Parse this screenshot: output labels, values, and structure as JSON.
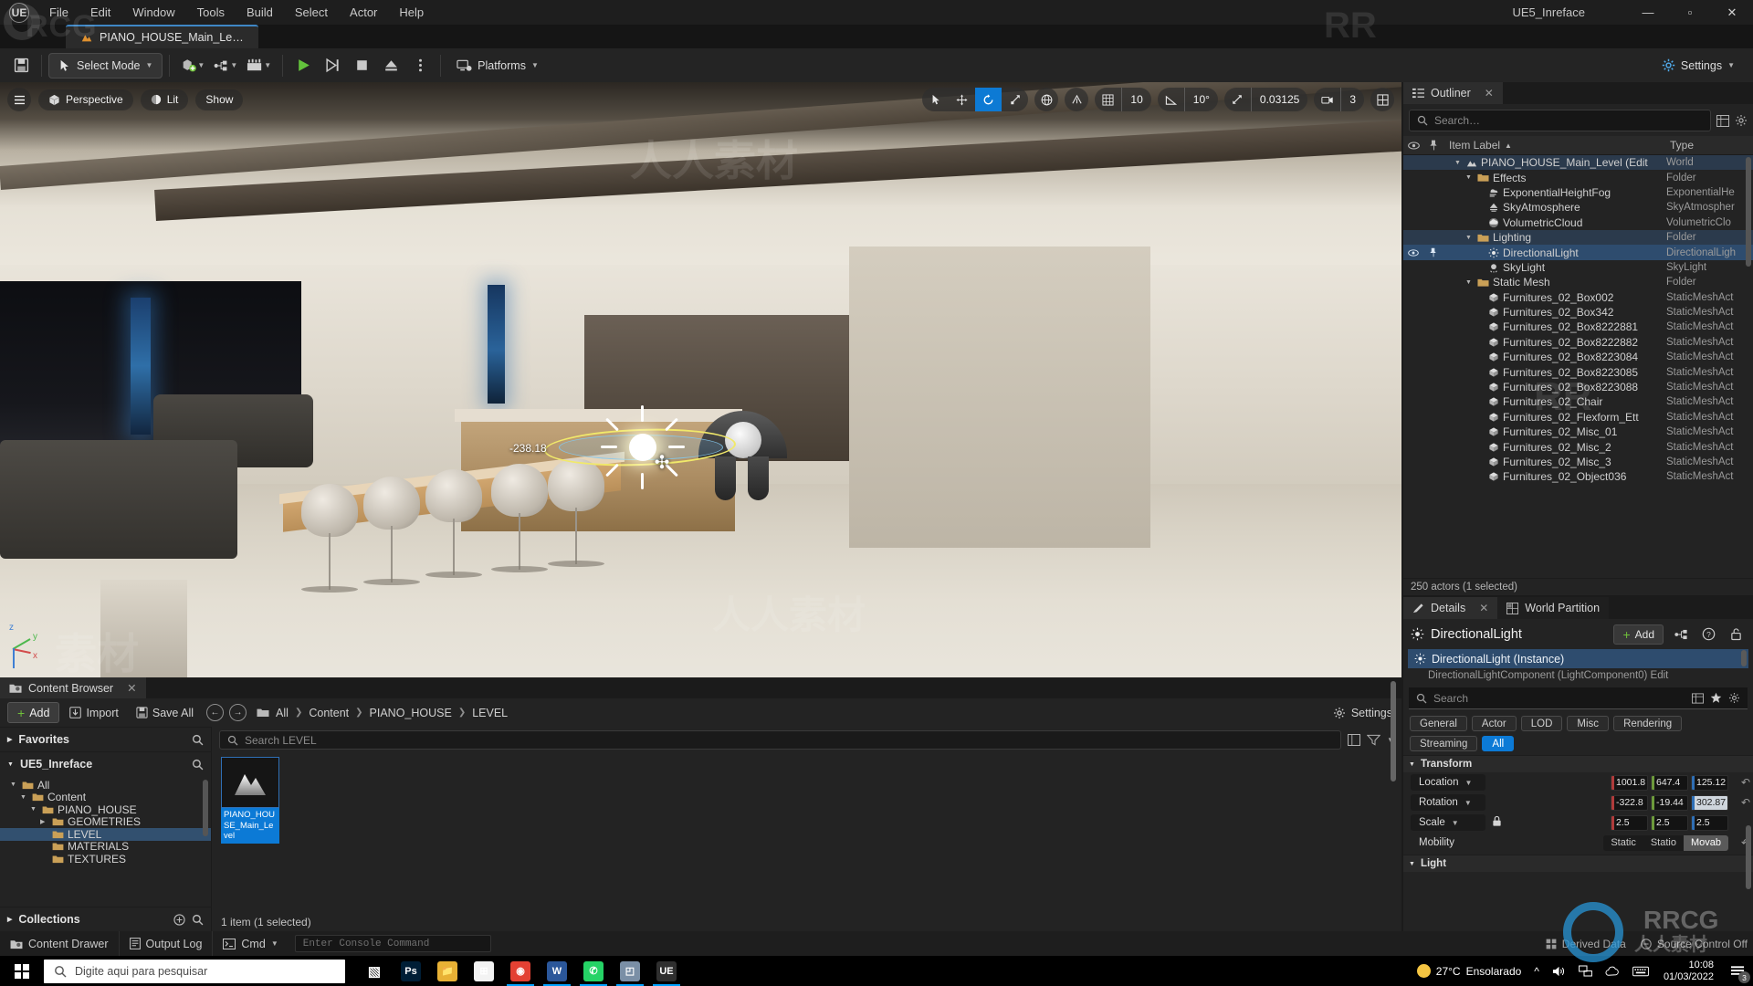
{
  "titlebar": {
    "menus": [
      "File",
      "Edit",
      "Window",
      "Tools",
      "Build",
      "Select",
      "Actor",
      "Help"
    ],
    "project": "UE5_Inreface",
    "minimize": "—",
    "maximize": "▫",
    "close": "✕"
  },
  "level_tab": {
    "label": "PIANO_HOUSE_Main_Le…"
  },
  "toolbar": {
    "save_icon": "save-icon",
    "select_mode": "Select Mode",
    "platforms": "Platforms",
    "settings": "Settings",
    "play_icon": "play-icon",
    "skip_icon": "skip-icon",
    "stop_icon": "stop-icon",
    "eject_icon": "eject-icon",
    "more_icon": "more-options-icon"
  },
  "viewport": {
    "menu_icon": "hamburger-icon",
    "perspective": "Perspective",
    "lit": "Lit",
    "show": "Show",
    "grid_snap": "10",
    "angle_snap": "10°",
    "scale_snap": "0.03125",
    "camera_speed": "3",
    "coord_label": "-238.18",
    "axis_x": "x",
    "axis_y": "y",
    "axis_z": "z"
  },
  "outliner": {
    "tab": "Outliner",
    "close": "✕",
    "search_placeholder": "Search…",
    "col_item_label": "Item Label",
    "col_type": "Type",
    "sort_arrow": "▲",
    "status": "250 actors (1 selected)",
    "rows": [
      {
        "label": "PIANO_HOUSE_Main_Level (Edit",
        "type": "World",
        "indent": 1,
        "icon": "level-icon",
        "expand": "▼",
        "state": "hl",
        "eye": false,
        "pin": false
      },
      {
        "label": "Effects",
        "type": "Folder",
        "indent": 2,
        "icon": "folder-icon",
        "expand": "▼",
        "state": "",
        "eye": false,
        "pin": false
      },
      {
        "label": "ExponentialHeightFog",
        "type": "ExponentialHe",
        "indent": 3,
        "icon": "fog-icon",
        "expand": "",
        "state": "",
        "eye": false,
        "pin": false
      },
      {
        "label": "SkyAtmosphere",
        "type": "SkyAtmospher",
        "indent": 3,
        "icon": "atmosphere-icon",
        "expand": "",
        "state": "",
        "eye": false,
        "pin": false
      },
      {
        "label": "VolumetricCloud",
        "type": "VolumetricClo",
        "indent": 3,
        "icon": "cloud-icon",
        "expand": "",
        "state": "",
        "eye": false,
        "pin": false
      },
      {
        "label": "Lighting",
        "type": "Folder",
        "indent": 2,
        "icon": "folder-icon",
        "expand": "▼",
        "state": "hl",
        "eye": false,
        "pin": false
      },
      {
        "label": "DirectionalLight",
        "type": "DirectionalLigh",
        "indent": 3,
        "icon": "light-icon",
        "expand": "",
        "state": "sel",
        "eye": true,
        "pin": true
      },
      {
        "label": "SkyLight",
        "type": "SkyLight",
        "indent": 3,
        "icon": "skylight-icon",
        "expand": "",
        "state": "",
        "eye": false,
        "pin": false
      },
      {
        "label": "Static Mesh",
        "type": "Folder",
        "indent": 2,
        "icon": "folder-icon",
        "expand": "▼",
        "state": "",
        "eye": false,
        "pin": false
      },
      {
        "label": "Furnitures_02_Box002",
        "type": "StaticMeshAct",
        "indent": 3,
        "icon": "mesh-icon",
        "expand": "",
        "state": "",
        "eye": false,
        "pin": false
      },
      {
        "label": "Furnitures_02_Box342",
        "type": "StaticMeshAct",
        "indent": 3,
        "icon": "mesh-icon",
        "expand": "",
        "state": "",
        "eye": false,
        "pin": false
      },
      {
        "label": "Furnitures_02_Box8222881",
        "type": "StaticMeshAct",
        "indent": 3,
        "icon": "mesh-icon",
        "expand": "",
        "state": "",
        "eye": false,
        "pin": false
      },
      {
        "label": "Furnitures_02_Box8222882",
        "type": "StaticMeshAct",
        "indent": 3,
        "icon": "mesh-icon",
        "expand": "",
        "state": "",
        "eye": false,
        "pin": false
      },
      {
        "label": "Furnitures_02_Box8223084",
        "type": "StaticMeshAct",
        "indent": 3,
        "icon": "mesh-icon",
        "expand": "",
        "state": "",
        "eye": false,
        "pin": false
      },
      {
        "label": "Furnitures_02_Box8223085",
        "type": "StaticMeshAct",
        "indent": 3,
        "icon": "mesh-icon",
        "expand": "",
        "state": "",
        "eye": false,
        "pin": false
      },
      {
        "label": "Furnitures_02_Box8223088",
        "type": "StaticMeshAct",
        "indent": 3,
        "icon": "mesh-icon",
        "expand": "",
        "state": "",
        "eye": false,
        "pin": false
      },
      {
        "label": "Furnitures_02_Chair",
        "type": "StaticMeshAct",
        "indent": 3,
        "icon": "mesh-icon",
        "expand": "",
        "state": "",
        "eye": false,
        "pin": false
      },
      {
        "label": "Furnitures_02_Flexform_Ett",
        "type": "StaticMeshAct",
        "indent": 3,
        "icon": "mesh-icon",
        "expand": "",
        "state": "",
        "eye": false,
        "pin": false
      },
      {
        "label": "Furnitures_02_Misc_01",
        "type": "StaticMeshAct",
        "indent": 3,
        "icon": "mesh-icon",
        "expand": "",
        "state": "",
        "eye": false,
        "pin": false
      },
      {
        "label": "Furnitures_02_Misc_2",
        "type": "StaticMeshAct",
        "indent": 3,
        "icon": "mesh-icon",
        "expand": "",
        "state": "",
        "eye": false,
        "pin": false
      },
      {
        "label": "Furnitures_02_Misc_3",
        "type": "StaticMeshAct",
        "indent": 3,
        "icon": "mesh-icon",
        "expand": "",
        "state": "",
        "eye": false,
        "pin": false
      },
      {
        "label": "Furnitures_02_Object036",
        "type": "StaticMeshAct",
        "indent": 3,
        "icon": "mesh-icon",
        "expand": "",
        "state": "",
        "eye": false,
        "pin": false
      }
    ]
  },
  "details": {
    "tab": "Details",
    "close": "✕",
    "world_partition_tab": "World Partition",
    "actor_name": "DirectionalLight",
    "add_label": "Add",
    "selected_component": "DirectionalLight (Instance)",
    "sub_component": "DirectionalLightComponent (LightComponent0)  Edit",
    "search_placeholder": "Search",
    "filters": [
      "General",
      "Actor",
      "LOD",
      "Misc",
      "Rendering",
      "Streaming",
      "All"
    ],
    "active_filter": "All",
    "transform_section": "Transform",
    "light_section": "Light",
    "location_label": "Location",
    "rotation_label": "Rotation",
    "scale_label": "Scale",
    "mobility_label": "Mobility",
    "location": [
      "1001.8",
      "647.4",
      "125.12"
    ],
    "rotation": [
      "-322.8",
      "-19.44",
      "302.87"
    ],
    "scale": [
      "2.5",
      "2.5",
      "2.5"
    ],
    "mobility_options": [
      "Static",
      "Statio",
      "Movab"
    ],
    "mobility_active": "Movab"
  },
  "content_browser": {
    "tab": "Content Browser",
    "close": "✕",
    "add": "Add",
    "import": "Import",
    "save_all": "Save All",
    "breadcrumbs": [
      "All",
      "Content",
      "PIANO_HOUSE",
      "LEVEL"
    ],
    "settings": "Settings",
    "favorites": "Favorites",
    "source_root": "UE5_Inreface",
    "collections": "Collections",
    "search_placeholder": "Search LEVEL",
    "tree": [
      {
        "label": "All",
        "indent": 1,
        "expand": "▼",
        "sel": false
      },
      {
        "label": "Content",
        "indent": 2,
        "expand": "▼",
        "sel": false
      },
      {
        "label": "PIANO_HOUSE",
        "indent": 3,
        "expand": "▼",
        "sel": false
      },
      {
        "label": "GEOMETRIES",
        "indent": 4,
        "expand": "▶",
        "sel": false
      },
      {
        "label": "LEVEL",
        "indent": 4,
        "expand": "",
        "sel": true
      },
      {
        "label": "MATERIALS",
        "indent": 4,
        "expand": "",
        "sel": false
      },
      {
        "label": "TEXTURES",
        "indent": 4,
        "expand": "",
        "sel": false
      }
    ],
    "asset": {
      "name": "PIANO_HOUSE_Main_Level",
      "icon": "level-thumbnail"
    },
    "footer": "1 item (1 selected)"
  },
  "statusbar": {
    "content_drawer": "Content Drawer",
    "output_log": "Output Log",
    "cmd": "Cmd",
    "console_placeholder": "Enter Console Command",
    "derived_data": "Derived Data",
    "source_control": "Source Control Off"
  },
  "taskbar": {
    "search_placeholder": "Digite aqui para pesquisar",
    "apps": [
      {
        "name": "task-view-icon",
        "glyph": "▧",
        "color": "transparent",
        "active": false
      },
      {
        "name": "photoshop-icon",
        "glyph": "Ps",
        "color": "#001e36",
        "active": false
      },
      {
        "name": "file-explorer-icon",
        "glyph": "📁",
        "color": "#e8b135",
        "active": false
      },
      {
        "name": "microsoft-store-icon",
        "glyph": "⊞",
        "color": "#f3f3f3",
        "active": false
      },
      {
        "name": "chrome-icon",
        "glyph": "◉",
        "color": "#e34133",
        "active": true
      },
      {
        "name": "word-icon",
        "glyph": "W",
        "color": "#2b579a",
        "active": true
      },
      {
        "name": "whatsapp-icon",
        "glyph": "✆",
        "color": "#25d366",
        "active": true
      },
      {
        "name": "image-viewer-icon",
        "glyph": "◰",
        "color": "#7a8fa6",
        "active": true
      },
      {
        "name": "unreal-engine-icon",
        "glyph": "UE",
        "color": "#2f2f2f",
        "active": true
      }
    ],
    "weather_temp": "27°C",
    "weather_desc": "Ensolarado",
    "time": "10:08",
    "date": "01/03/2022",
    "notification_count": "3"
  },
  "colors": {
    "accent_blue": "#0c7ad6",
    "selection_blue": "#2e4c6e",
    "panel_bg": "#232323",
    "axis_x": "#b03b3b",
    "axis_y": "#6d9a3b",
    "axis_z": "#2f6fb5",
    "gizmo_yellow": "#f1e96a"
  }
}
